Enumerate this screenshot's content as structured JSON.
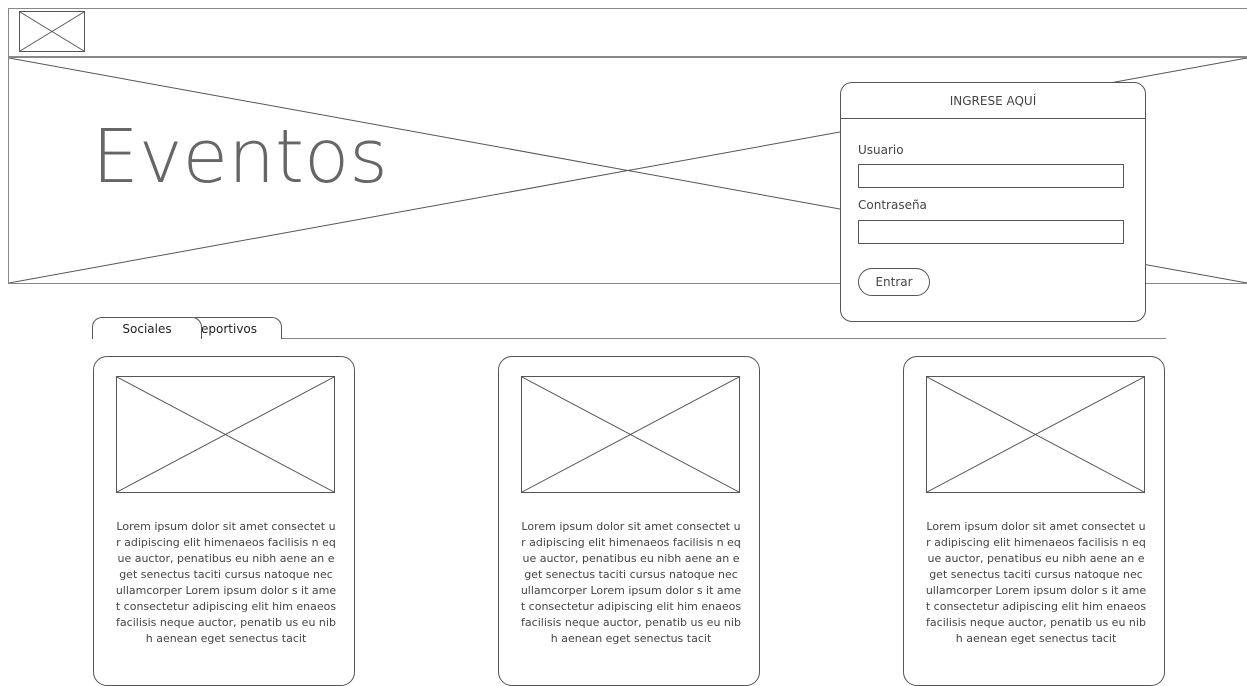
{
  "header": {
    "logo_icon": "image-placeholder-icon"
  },
  "hero": {
    "title": "Eventos"
  },
  "login": {
    "title": "INGRESE AQUÍ",
    "user_label": "Usuario",
    "user_value": "",
    "password_label": "Contraseña",
    "password_value": "",
    "submit_label": "Entrar"
  },
  "tabs": [
    {
      "label": "Sociales",
      "active": true
    },
    {
      "label": "eportivos",
      "active": false
    }
  ],
  "cards": [
    {
      "image_icon": "image-placeholder-icon",
      "text": "Lorem ipsum dolor sit amet consectet ur adipiscing elit himenaeos facilisis n eque auctor, penatibus eu nibh aene an eget senectus taciti cursus natoque  nec ullamcorper Lorem ipsum dolor s it amet consectetur adipiscing elit him enaeos facilisis neque auctor, penatib us eu nibh aenean eget senectus tacit"
    },
    {
      "image_icon": "image-placeholder-icon",
      "text": "Lorem ipsum dolor sit amet consectet ur adipiscing elit himenaeos facilisis n eque auctor, penatibus eu nibh aene an eget senectus taciti cursus natoque  nec ullamcorper Lorem ipsum dolor s it amet consectetur adipiscing elit him enaeos facilisis neque auctor, penatib us eu nibh aenean eget senectus tacit"
    },
    {
      "image_icon": "image-placeholder-icon",
      "text": "Lorem ipsum dolor sit amet consectet ur adipiscing elit himenaeos facilisis n eque auctor, penatibus eu nibh aene an eget senectus taciti cursus natoque  nec ullamcorper Lorem ipsum dolor s it amet consectetur adipiscing elit him enaeos facilisis neque auctor, penatib us eu nibh aenean eget senectus tacit"
    }
  ]
}
